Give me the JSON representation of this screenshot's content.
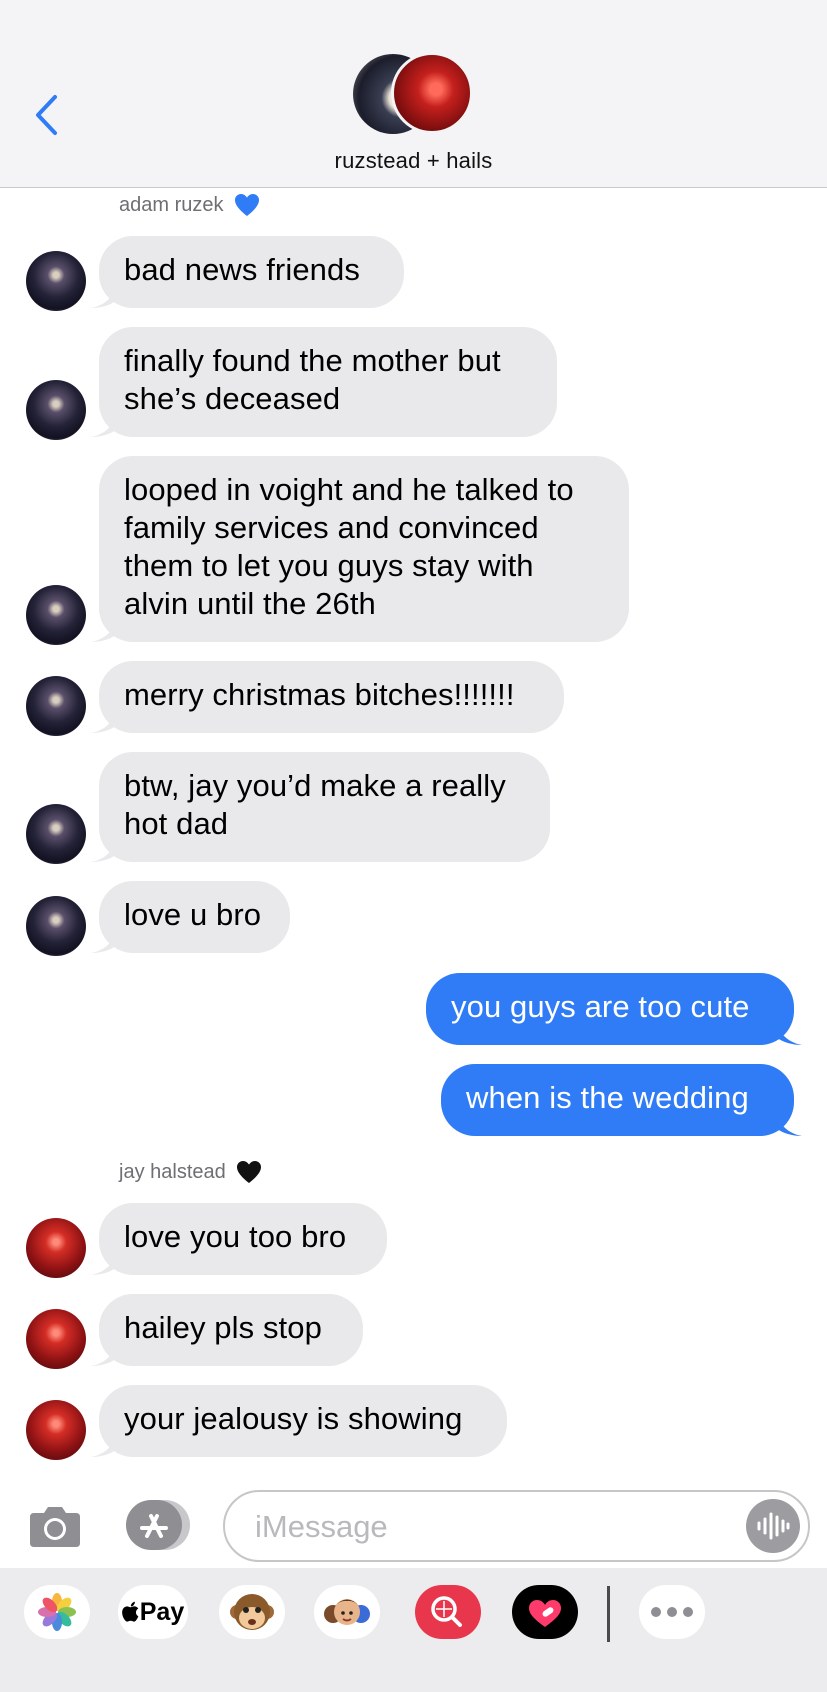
{
  "header": {
    "title": "ruzstead + hails"
  },
  "senders": {
    "adam": "adam ruzek",
    "jay": "jay halstead"
  },
  "messages": [
    {
      "text": "bad news friends"
    },
    {
      "text": "finally found the mother but she’s deceased"
    },
    {
      "text": "looped in voight and he talked to family services and convinced them to let you guys stay with alvin until the 26th"
    },
    {
      "text": "merry christmas bitches!!!!!!!"
    },
    {
      "text": "btw, jay you’d make a really hot dad"
    },
    {
      "text": "love u bro"
    },
    {
      "text": "you guys are too cute"
    },
    {
      "text": "when is the wedding"
    },
    {
      "text": "love you too bro"
    },
    {
      "text": "hailey pls stop"
    },
    {
      "text": "your jealousy is showing"
    }
  ],
  "input": {
    "placeholder": "iMessage"
  },
  "app_drawer": {
    "apple_pay_label": "Pay",
    "icons": [
      "photos-icon",
      "apple-pay-icon",
      "monkey-animoji-icon",
      "memoji-icon",
      "image-search-icon",
      "digital-touch-icon",
      "more-icon"
    ]
  },
  "colors": {
    "outgoing_bubble": "#2f7cf6",
    "incoming_bubble": "#e9e9eb",
    "accent": "#2f7cf6",
    "adam_heart": "#2f7cf6",
    "jay_heart": "#000000"
  }
}
